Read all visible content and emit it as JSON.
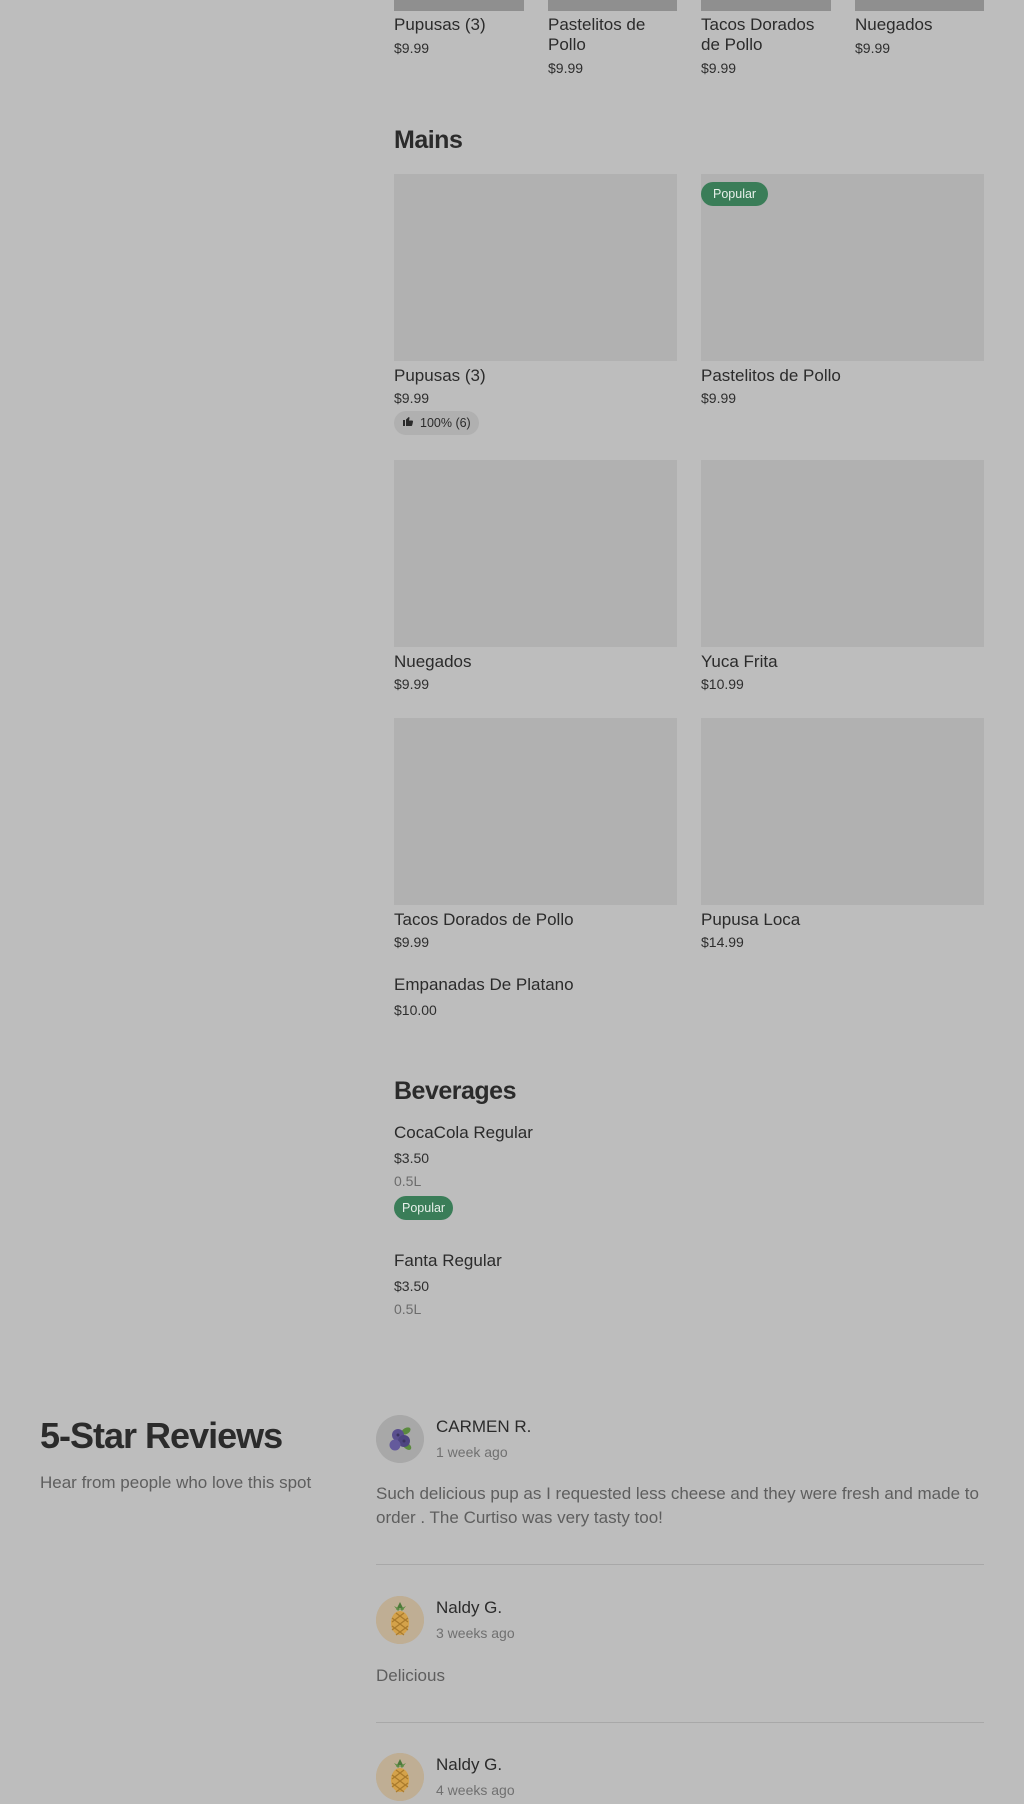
{
  "top_strip": [
    {
      "name": "Pupusas (3)",
      "price": "$9.99"
    },
    {
      "name": "Pastelitos de Pollo",
      "price": "$9.99"
    },
    {
      "name": "Tacos Dorados de Pollo",
      "price": "$9.99"
    },
    {
      "name": "Nuegados",
      "price": "$9.99"
    }
  ],
  "mains": {
    "title": "Mains",
    "items": [
      {
        "name": "Pupusas (3)",
        "price": "$9.99",
        "rating": "100% (6)"
      },
      {
        "name": "Pastelitos de Pollo",
        "price": "$9.99",
        "badge": "Popular"
      },
      {
        "name": "Nuegados",
        "price": "$9.99"
      },
      {
        "name": "Yuca Frita",
        "price": "$10.99"
      },
      {
        "name": "Tacos Dorados de Pollo",
        "price": "$9.99"
      },
      {
        "name": "Pupusa Loca",
        "price": "$14.99"
      },
      {
        "name": "Empanadas De Platano",
        "price": "$10.00"
      }
    ]
  },
  "beverages": {
    "title": "Beverages",
    "items": [
      {
        "name": "CocaCola Regular",
        "price": "$3.50",
        "size": "0.5L",
        "badge": "Popular"
      },
      {
        "name": "Fanta Regular",
        "price": "$3.50",
        "size": "0.5L"
      }
    ]
  },
  "reviews": {
    "title": "5-Star Reviews",
    "subtitle": "Hear from people who love this spot",
    "items": [
      {
        "name": "CARMEN R.",
        "time": "1 week ago",
        "avatar": "blueberry-icon",
        "text": "Such delicious pup as I requested less cheese and they were fresh and made to order . The Curtiso was very tasty too!"
      },
      {
        "name": "Naldy G.",
        "time": "3 weeks ago",
        "avatar": "pineapple-icon",
        "text": "Delicious"
      },
      {
        "name": "Naldy G.",
        "time": "4 weeks ago",
        "avatar": "pineapple-icon"
      }
    ]
  },
  "colors": {
    "popular_badge": "#3a7d58",
    "background": "#bdbdbd"
  }
}
